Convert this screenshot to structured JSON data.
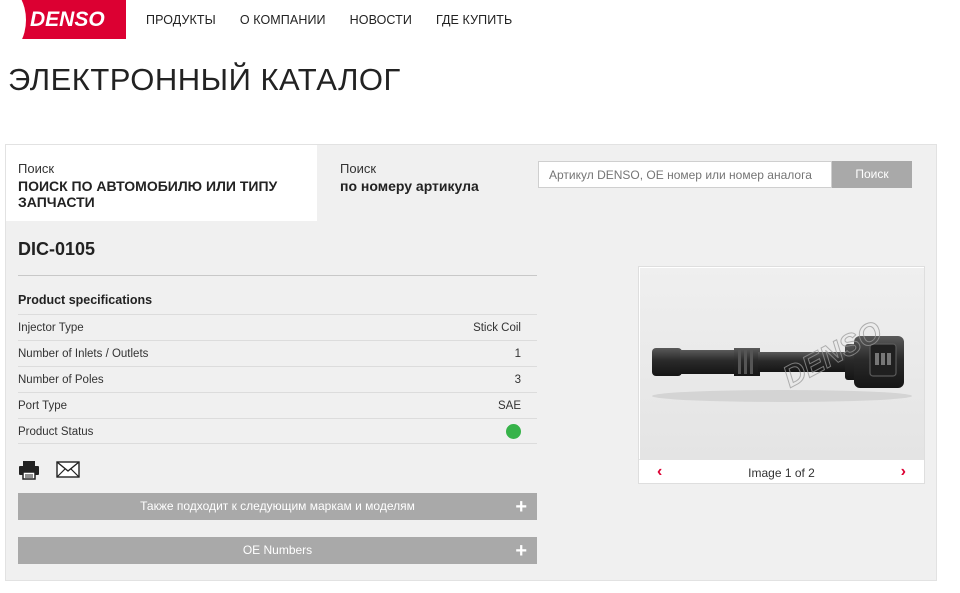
{
  "brand": {
    "logo_text": "DENSO",
    "accent": "#dc0032"
  },
  "nav": [
    "ПРОДУКТЫ",
    "О КОМПАНИИ",
    "НОВОСТИ",
    "ГДЕ КУПИТЬ"
  ],
  "page_title": "ЭЛЕКТРОННЫЙ КАТАЛОГ",
  "search": {
    "tab_vehicle": {
      "small": "Поиск",
      "big": "ПОИСК ПО АВТОМОБИЛЮ ИЛИ ТИПУ ЗАПЧАСТИ"
    },
    "tab_article": {
      "small": "Поиск",
      "big": "по номеру артикула"
    },
    "placeholder": "Артикул DENSO, OE номер или номер аналога",
    "button": "Поиск"
  },
  "product": {
    "part_number": "DIC-0105",
    "spec_title": "Product specifications",
    "specs": [
      {
        "label": "Injector Type",
        "value": "Stick Coil"
      },
      {
        "label": "Number of Inlets / Outlets",
        "value": "1"
      },
      {
        "label": "Number of Poles",
        "value": "3"
      },
      {
        "label": "Port Type",
        "value": "SAE"
      },
      {
        "label": "Product Status",
        "value": ""
      }
    ],
    "status_color": "#37b34a",
    "icons": [
      "print-icon",
      "email-icon"
    ],
    "accordions": [
      {
        "label": "Также подходит к следующим маркам и моделям",
        "icon": "+"
      },
      {
        "label": "OE Numbers",
        "icon": "+"
      }
    ]
  },
  "viewer": {
    "watermark": "DENSO",
    "pager_text": "Image 1 of 2",
    "prev": "‹",
    "next": "›"
  }
}
